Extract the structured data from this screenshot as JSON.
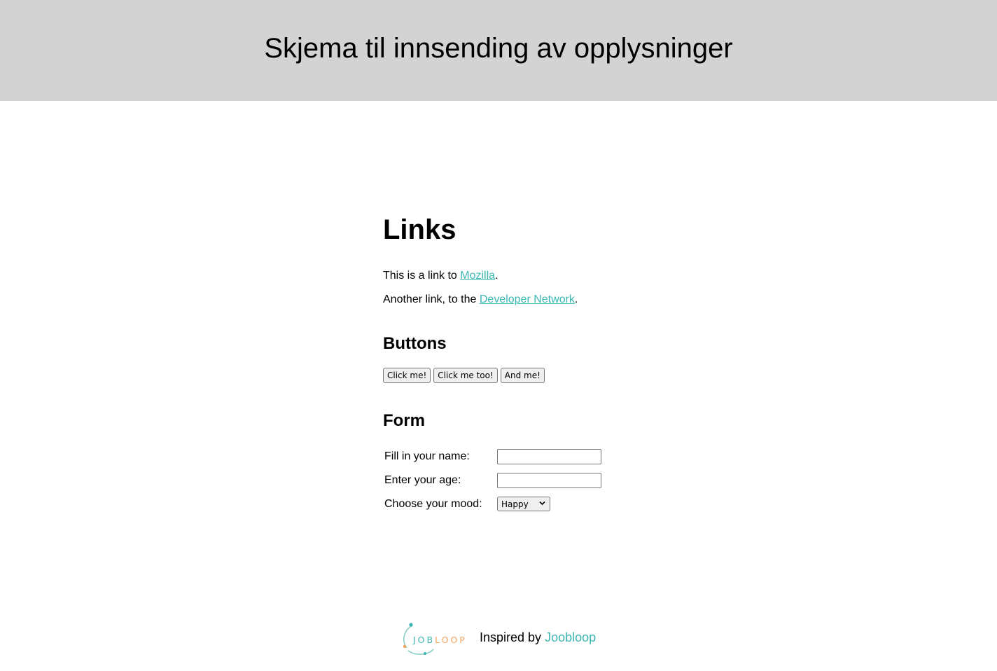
{
  "header": {
    "title": "Skjema til innsending av opplysninger"
  },
  "links_section": {
    "heading": "Links",
    "p1_prefix": "This is a link to ",
    "p1_link": "Mozilla",
    "p1_suffix": ".",
    "p2_prefix": "Another link, to the ",
    "p2_link": "Developer Network",
    "p2_suffix": "."
  },
  "buttons_section": {
    "heading": "Buttons",
    "buttons": [
      "Click me!",
      "Click me too!",
      "And me!"
    ]
  },
  "form_section": {
    "heading": "Form",
    "name_label": "Fill in your name:",
    "name_value": "",
    "age_label": "Enter your age:",
    "age_value": "",
    "mood_label": "Choose your mood:",
    "mood_selected": "Happy"
  },
  "footer": {
    "logo_text": "JOBLOOP",
    "inspired_prefix": "Inspired by ",
    "brand": "Joobloop"
  },
  "colors": {
    "header_bg": "#d3d3d3",
    "link": "#3cb6b2",
    "logo_orange": "#f0a35e"
  },
  "icons": {
    "select_arrow": "chevron-down-icon",
    "logo": "jobloop-logo"
  }
}
